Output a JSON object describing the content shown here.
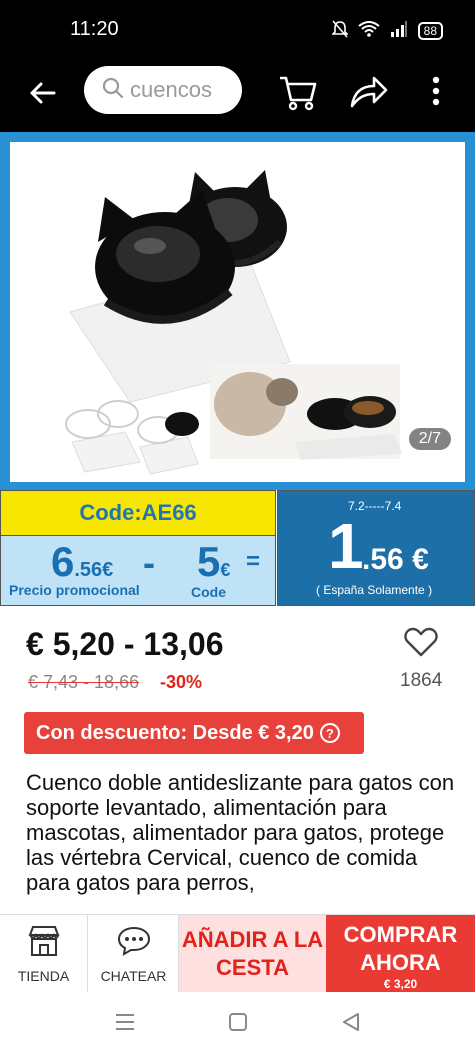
{
  "status_bar": {
    "time": "11:20",
    "battery": "88"
  },
  "search": {
    "placeholder": "cuencos"
  },
  "gallery": {
    "counter": "2/7"
  },
  "promo": {
    "code_label": "Code:AE66",
    "promo_price_int": "6",
    "promo_price_dec": ".56",
    "promo_price_cur": "€",
    "minus": "-",
    "code_value": "5",
    "code_cur": "€",
    "equals": "=",
    "promo_price_label": "Precio promocional",
    "code_word": "Code",
    "date_range": "7.2-----7.4",
    "final_int": "1",
    "final_dec": ".56",
    "final_cur": "€",
    "region_note": "( España Solamente )"
  },
  "price": {
    "range": "€ 5,20 - 13,06",
    "original": "€ 7,43 - 18,66",
    "discount": "-30%",
    "wishlist_count": "1864"
  },
  "coupon": {
    "label": "Con descuento: Desde € 3,20"
  },
  "product": {
    "title": "Cuenco doble antideslizante para gatos con soporte levantado, alimentación para mascotas, alimentador para gatos, protege las vértebra Cervical, cuenco de comida para gatos para perros,"
  },
  "actions": {
    "store": "TIENDA",
    "chat": "CHATEAR",
    "add_to_cart": "AÑADIR A LA CESTA",
    "buy_now": "COMPRAR AHORA",
    "buy_price": "€ 3,20"
  },
  "colors": {
    "accent_red": "#e8413b",
    "promo_yellow": "#f6e600",
    "promo_blue": "#1d6fa8"
  }
}
